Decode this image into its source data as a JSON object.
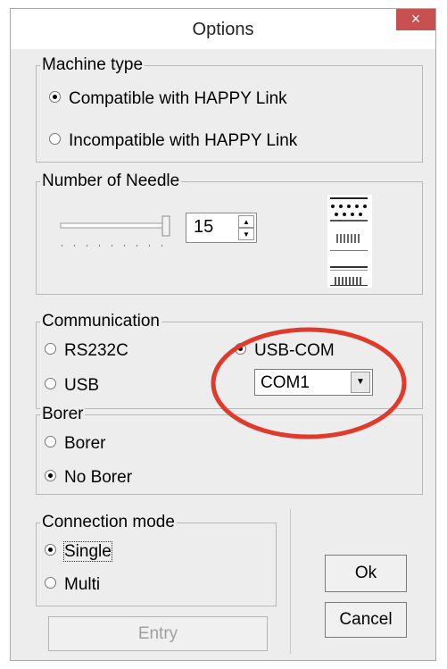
{
  "window": {
    "title": "Options",
    "close_symbol": "×"
  },
  "machine_type": {
    "legend": "Machine type",
    "options": [
      "Compatible with HAPPY Link",
      "Incompatible with HAPPY Link"
    ],
    "selected": 0
  },
  "needle": {
    "legend": "Number of Needle",
    "value": "15",
    "up_arrow": "▲",
    "down_arrow": "▼"
  },
  "communication": {
    "legend": "Communication",
    "options": [
      "RS232C",
      "USB",
      "USB-COM"
    ],
    "selected": 2,
    "port": {
      "value": "COM1",
      "arrow": "▼"
    }
  },
  "borer": {
    "legend": "Borer",
    "options": [
      "Borer",
      "No Borer"
    ],
    "selected": 1
  },
  "connection_mode": {
    "legend": "Connection mode",
    "options": [
      "Single",
      "Multi"
    ],
    "selected": 0
  },
  "buttons": {
    "entry": "Entry",
    "ok": "Ok",
    "cancel": "Cancel"
  },
  "annotation": {
    "color": "#e03a2a"
  }
}
